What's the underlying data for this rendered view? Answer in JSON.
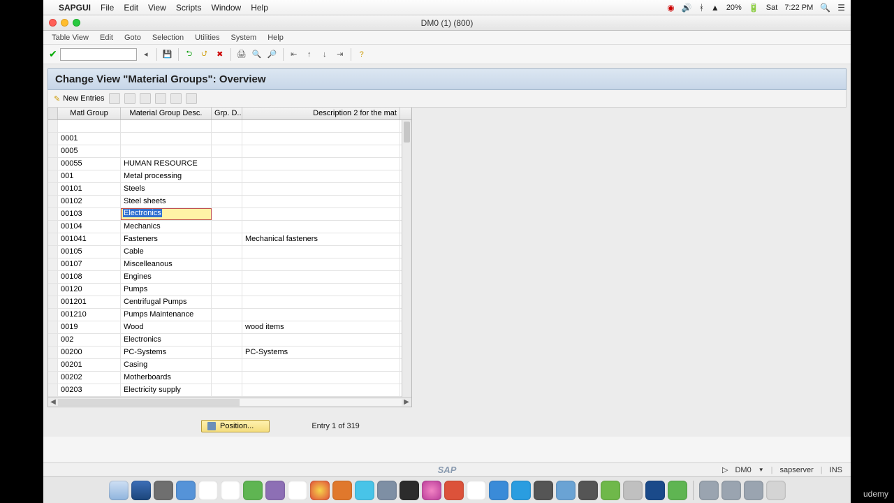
{
  "mac_menubar": {
    "apple": "",
    "app": "SAPGUI",
    "items": [
      "File",
      "Edit",
      "View",
      "Scripts",
      "Window",
      "Help"
    ],
    "right": {
      "battery": "20%",
      "charging": "⚡",
      "day": "Sat",
      "time": "7:22 PM"
    }
  },
  "window": {
    "title": "DM0 (1) (800)"
  },
  "sap_menubar": [
    "Table View",
    "Edit",
    "Goto",
    "Selection",
    "Utilities",
    "System",
    "Help"
  ],
  "panel": {
    "title": "Change View \"Material Groups\": Overview",
    "new_entries": "New Entries"
  },
  "grid": {
    "headers": [
      "",
      "Matl Group",
      "Material Group Desc.",
      "Grp. D...",
      "Description 2 for the mat"
    ],
    "rows": [
      {
        "mg": "",
        "desc": "",
        "g": "",
        "d2": ""
      },
      {
        "mg": "0001",
        "desc": "",
        "g": "",
        "d2": ""
      },
      {
        "mg": "0005",
        "desc": "",
        "g": "",
        "d2": ""
      },
      {
        "mg": "00055",
        "desc": "HUMAN RESOURCE",
        "g": "",
        "d2": ""
      },
      {
        "mg": "001",
        "desc": "Metal processing",
        "g": "",
        "d2": ""
      },
      {
        "mg": "00101",
        "desc": "Steels",
        "g": "",
        "d2": ""
      },
      {
        "mg": "00102",
        "desc": "Steel sheets",
        "g": "",
        "d2": ""
      },
      {
        "mg": "00103",
        "desc": "Electronics",
        "g": "",
        "d2": "",
        "editing": true
      },
      {
        "mg": "00104",
        "desc": "Mechanics",
        "g": "",
        "d2": ""
      },
      {
        "mg": "001041",
        "desc": "Fasteners",
        "g": "",
        "d2": "Mechanical fasteners"
      },
      {
        "mg": "00105",
        "desc": "Cable",
        "g": "",
        "d2": ""
      },
      {
        "mg": "00107",
        "desc": "Miscelleanous",
        "g": "",
        "d2": ""
      },
      {
        "mg": "00108",
        "desc": "Engines",
        "g": "",
        "d2": ""
      },
      {
        "mg": "00120",
        "desc": "Pumps",
        "g": "",
        "d2": ""
      },
      {
        "mg": "001201",
        "desc": "Centrifugal Pumps",
        "g": "",
        "d2": ""
      },
      {
        "mg": "001210",
        "desc": "Pumps Maintenance",
        "g": "",
        "d2": ""
      },
      {
        "mg": "0019",
        "desc": "Wood",
        "g": "",
        "d2": "wood items"
      },
      {
        "mg": "002",
        "desc": "Electronics",
        "g": "",
        "d2": ""
      },
      {
        "mg": "00200",
        "desc": "PC-Systems",
        "g": "",
        "d2": "PC-Systems"
      },
      {
        "mg": "00201",
        "desc": "Casing",
        "g": "",
        "d2": ""
      },
      {
        "mg": "00202",
        "desc": "Motherboards",
        "g": "",
        "d2": ""
      },
      {
        "mg": "00203",
        "desc": "Electricity supply",
        "g": "",
        "d2": ""
      }
    ]
  },
  "footer": {
    "position": "Position...",
    "entry": "Entry 1 of 319"
  },
  "statusbar": {
    "system": "DM0",
    "server": "sapserver",
    "mode": "INS",
    "sap": "SAP"
  },
  "branding": "udemy"
}
